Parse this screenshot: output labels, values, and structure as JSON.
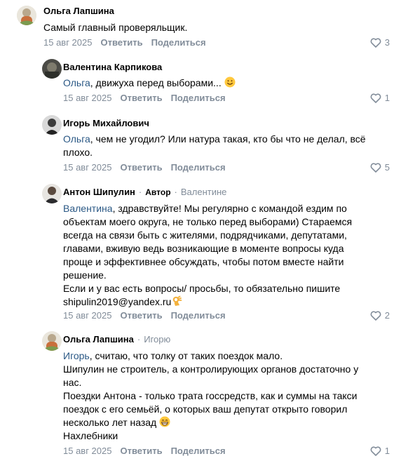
{
  "comments": [
    {
      "author": "Ольга Лапшина",
      "text_lines": [
        "Самый главный проверяльщик."
      ],
      "date": "15 авг 2025",
      "reply_label": "Ответить",
      "share_label": "Поделиться",
      "likes": "3"
    },
    {
      "author": "Валентина Карпикова",
      "mention": "Ольга",
      "text_after_mention": ", движуха перед выборами...",
      "emoji": "smiling-face-emoji",
      "date": "15 авг 2025",
      "reply_label": "Ответить",
      "share_label": "Поделиться",
      "likes": "1"
    },
    {
      "author": "Игорь Михайлович",
      "mention": "Ольга",
      "text_after_mention": ", чем не угодил? Или натура такая, кто бы что не делал, всё",
      "text_lines": [
        "плохо."
      ],
      "date": "15 авг 2025",
      "reply_label": "Ответить",
      "share_label": "Поделиться",
      "likes": "5"
    },
    {
      "author": "Антон Шипулин",
      "badge": "Автор",
      "reply_to": "Валентине",
      "mention": "Валентина",
      "text_after_mention": ", здравствуйте! Мы регулярно с командой ездим по",
      "text_lines": [
        "объектам моего округа, не только перед выборами) Стараемся",
        "всегда на связи быть с жителями, подрядчиками, депутатами,",
        "главами, вживую ведь возникающие в моменте вопросы куда",
        "проще и эффективнее обсуждать, чтобы потом вместе найти",
        "решение.",
        "Если и у вас есть вопросы/ просьбы, то обязательно пишите"
      ],
      "last_line": "shipulin2019@yandex.ru",
      "emoji": "ok-hand-emoji",
      "date": "15 авг 2025",
      "reply_label": "Ответить",
      "share_label": "Поделиться",
      "likes": "2"
    },
    {
      "author": "Ольга Лапшина",
      "reply_to": "Игорю",
      "mention": "Игорь",
      "text_after_mention": ", считаю, что толку от таких поездок мало.",
      "text_lines": [
        "Шипулин не строитель, а контролирующих органов достаточно у",
        "нас.",
        "Поездки Антона - только трата госсредств, как и суммы на такси",
        "поездок с его семьёй, о которых ваш депутат открыто говорил"
      ],
      "last_line": "несколько лет назад",
      "emoji": "grinning-face-emoji",
      "extra_line": "Нахлебники",
      "date": "15 авг 2025",
      "reply_label": "Ответить",
      "share_label": "Поделиться",
      "likes": "1"
    }
  ]
}
